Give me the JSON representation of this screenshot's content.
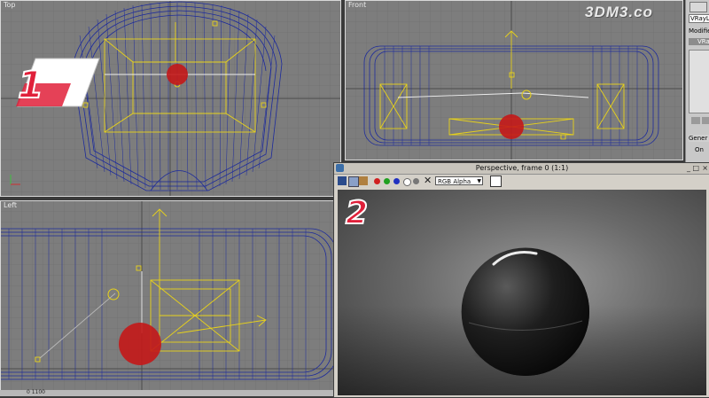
{
  "viewports": {
    "top": {
      "label": "Top"
    },
    "front": {
      "label": "Front"
    },
    "left": {
      "label": "Left"
    }
  },
  "watermark": "3DM3.co",
  "command_panel": {
    "object_name": "VRayLig",
    "modifier_list": "Modifier",
    "stack_item": "VRa",
    "rollout": "Gener",
    "option": "On"
  },
  "status_bar": {
    "coord": "0 1100"
  },
  "frame_buffer": {
    "title": "Perspective, frame 0 (1:1)",
    "channel": "RGB Alpha",
    "window_controls": [
      "_",
      "□",
      "×"
    ]
  },
  "badges": {
    "one": "1",
    "two": "2"
  },
  "icons": {
    "save": "save-icon",
    "copy": "copy-icon",
    "clone": "clone-icon",
    "red": "red-channel-icon",
    "green": "green-channel-icon",
    "blue": "blue-channel-icon",
    "alpha": "alpha-channel-icon",
    "mono": "mono-icon",
    "clear": "clear-icon"
  },
  "colors": {
    "viewport_bg": "#7d7d7d",
    "wire_blue": "#1c2a9c",
    "light_yellow": "#e8d21a",
    "sphere_red": "#c41818",
    "badge_red": "#e0203a"
  }
}
